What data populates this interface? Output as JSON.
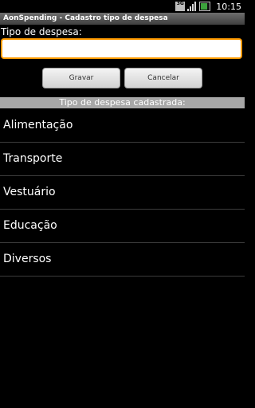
{
  "status_bar": {
    "time": "10:15",
    "icons": [
      "network-3g-icon",
      "signal-icon",
      "battery-charging-icon"
    ]
  },
  "app": {
    "title": "AonSpending - Cadastro tipo de despesa"
  },
  "form": {
    "label": "Tipo de despesa:",
    "input_value": "",
    "save_label": "Gravar",
    "cancel_label": "Cancelar",
    "focus_color": "#ff9a00"
  },
  "list": {
    "header": "Tipo de despesa cadastrada:",
    "items": [
      "Alimentação",
      "Transporte",
      "Vestuário",
      "Educação",
      "Diversos"
    ]
  }
}
